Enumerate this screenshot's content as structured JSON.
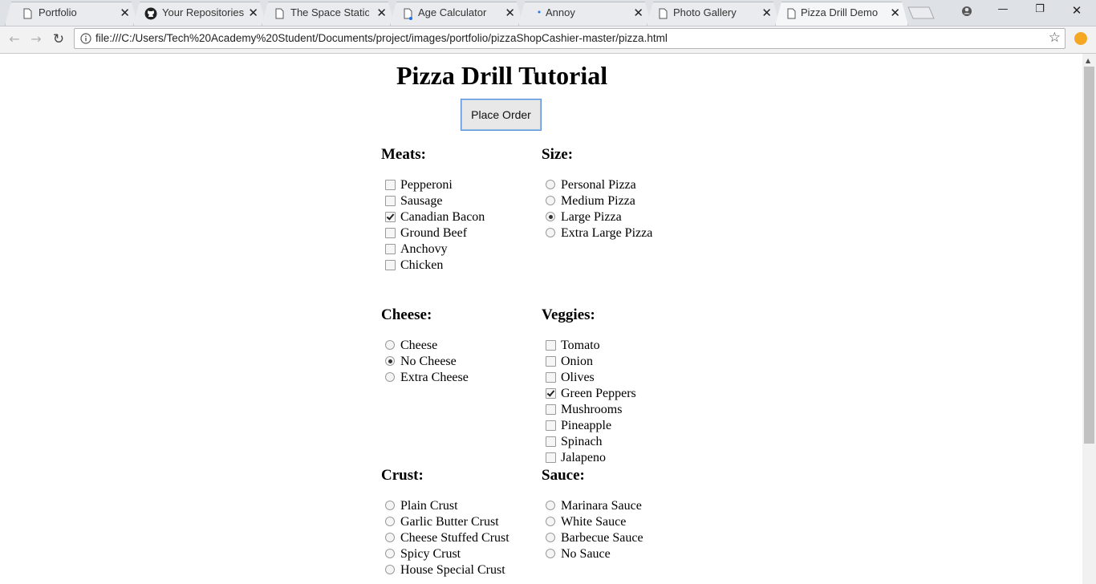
{
  "browser": {
    "tabs": [
      {
        "label": "Portfolio",
        "icon": "page-icon",
        "active": false
      },
      {
        "label": "Your Repositories",
        "icon": "github-icon",
        "active": false
      },
      {
        "label": "The Space Station",
        "icon": "page-icon",
        "active": false
      },
      {
        "label": "Age Calculator",
        "icon": "page-icon",
        "active": false
      },
      {
        "label": "Annoy",
        "icon": "loading-icon",
        "active": false
      },
      {
        "label": "Photo Gallery",
        "icon": "page-icon",
        "active": false
      },
      {
        "label": "Pizza Drill Demo",
        "icon": "page-icon",
        "active": true
      }
    ],
    "url": "file:///C:/Users/Tech%20Academy%20Student/Documents/project/images/portfolio/pizzaShopCashier-master/pizza.html"
  },
  "page": {
    "title": "Pizza Drill Tutorial",
    "place_order_label": "Place Order",
    "meats": {
      "heading": "Meats:",
      "items": [
        {
          "label": "Pepperoni",
          "checked": false
        },
        {
          "label": "Sausage",
          "checked": false
        },
        {
          "label": "Canadian Bacon",
          "checked": true
        },
        {
          "label": "Ground Beef",
          "checked": false
        },
        {
          "label": "Anchovy",
          "checked": false
        },
        {
          "label": "Chicken",
          "checked": false
        }
      ]
    },
    "size": {
      "heading": "Size:",
      "items": [
        {
          "label": "Personal Pizza",
          "checked": false
        },
        {
          "label": "Medium Pizza",
          "checked": false
        },
        {
          "label": "Large Pizza",
          "checked": true
        },
        {
          "label": "Extra Large Pizza",
          "checked": false
        }
      ]
    },
    "cheese": {
      "heading": "Cheese:",
      "items": [
        {
          "label": "Cheese",
          "checked": false
        },
        {
          "label": "No Cheese",
          "checked": true
        },
        {
          "label": "Extra Cheese",
          "checked": false
        }
      ]
    },
    "veggies": {
      "heading": "Veggies:",
      "items": [
        {
          "label": "Tomato",
          "checked": false
        },
        {
          "label": "Onion",
          "checked": false
        },
        {
          "label": "Olives",
          "checked": false
        },
        {
          "label": "Green Peppers",
          "checked": true
        },
        {
          "label": "Mushrooms",
          "checked": false
        },
        {
          "label": "Pineapple",
          "checked": false
        },
        {
          "label": "Spinach",
          "checked": false
        },
        {
          "label": "Jalapeno",
          "checked": false
        }
      ]
    },
    "crust": {
      "heading": "Crust:",
      "items": [
        {
          "label": "Plain Crust",
          "checked": false
        },
        {
          "label": "Garlic Butter Crust",
          "checked": false
        },
        {
          "label": "Cheese Stuffed Crust",
          "checked": false
        },
        {
          "label": "Spicy Crust",
          "checked": false
        },
        {
          "label": "House Special Crust",
          "checked": false
        }
      ]
    },
    "sauce": {
      "heading": "Sauce:",
      "items": [
        {
          "label": "Marinara Sauce",
          "checked": false
        },
        {
          "label": "White Sauce",
          "checked": false
        },
        {
          "label": "Barbecue Sauce",
          "checked": false
        },
        {
          "label": "No Sauce",
          "checked": false
        }
      ]
    }
  },
  "colors": {
    "focus_border": "#5b8fd6",
    "extension_badge": "#f5a623"
  }
}
